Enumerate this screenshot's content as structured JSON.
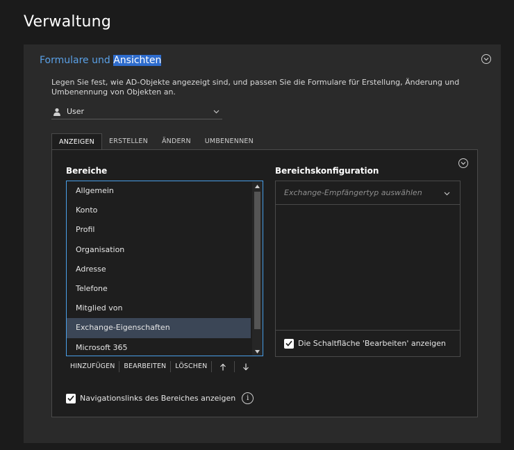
{
  "page": {
    "title": "Verwaltung"
  },
  "card": {
    "title_prefix": "Formulare und ",
    "title_highlight": "Ansichten",
    "description": "Legen Sie fest, wie AD-Objekte angezeigt sind, und passen Sie die Formulare für Erstellung, Änderung und Umbenennung von Objekten an.",
    "object_type": {
      "selected": "User",
      "icon": "user-icon"
    }
  },
  "tabs": [
    {
      "label": "ANZEIGEN",
      "active": true
    },
    {
      "label": "ERSTELLEN",
      "active": false
    },
    {
      "label": "ÄNDERN",
      "active": false
    },
    {
      "label": "UMBENENNEN",
      "active": false
    }
  ],
  "sections": {
    "label": "Bereiche",
    "items": [
      "Allgemein",
      "Konto",
      "Profil",
      "Organisation",
      "Adresse",
      "Telefone",
      "Mitglied von",
      "Exchange-Eigenschaften",
      "Microsoft 365"
    ],
    "selected_index": 7,
    "actions": {
      "add": "HINZUFÜGEN",
      "edit": "BEARBEITEN",
      "delete": "LÖSCHEN",
      "up": "↑",
      "down": "↓"
    }
  },
  "config": {
    "label": "Bereichskonfiguration",
    "dropdown_placeholder": "Exchange-Empfängertyp auswählen",
    "show_edit_button": {
      "label": "Die Schaltfläche 'Bearbeiten' anzeigen",
      "checked": true
    }
  },
  "nav_links": {
    "label": "Navigationslinks des Bereiches anzeigen",
    "checked": true,
    "info": "i"
  },
  "colors": {
    "accent": "#4aa0ea",
    "title_link": "#5aa0e6",
    "highlight": "#2e6ccd",
    "selected_row": "#3b4656"
  }
}
